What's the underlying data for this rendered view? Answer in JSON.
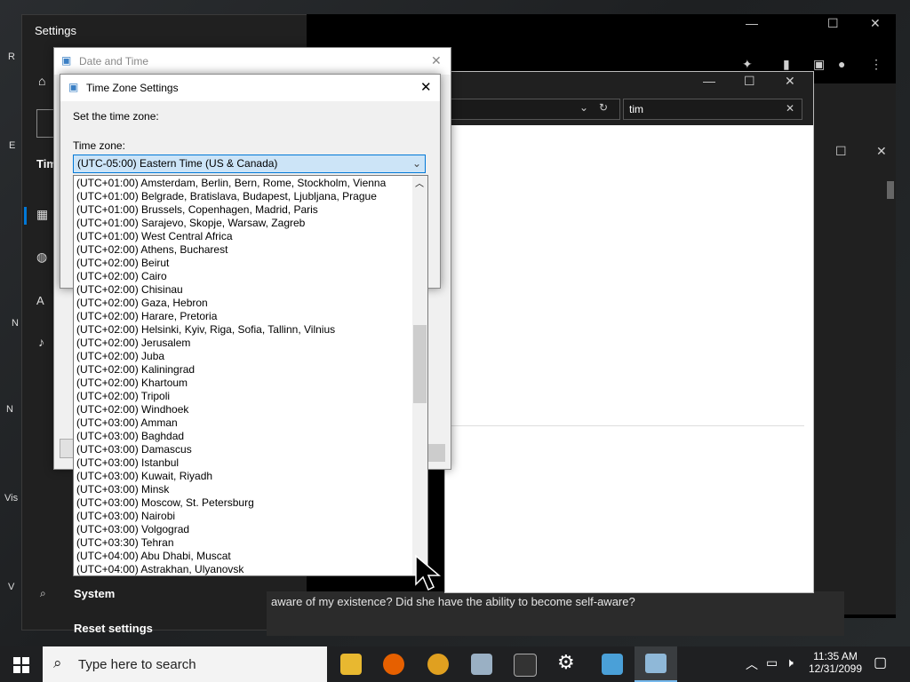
{
  "settings_window": {
    "title": "Settings",
    "nav": [
      "Tim",
      "System",
      "Reset settings"
    ]
  },
  "chrome": {
    "search_value": "tim"
  },
  "chat_text": "aware of my existence? Did she have the ability to become self-aware?",
  "date_time_dialog": {
    "title": "Date and Time"
  },
  "tz_dialog": {
    "title": "Time Zone Settings",
    "instruction": "Set the time zone:",
    "tz_label": "Time zone:",
    "selected": "(UTC-05:00) Eastern Time (US & Canada)",
    "options": [
      "(UTC+01:00) Amsterdam, Berlin, Bern, Rome, Stockholm, Vienna",
      "(UTC+01:00) Belgrade, Bratislava, Budapest, Ljubljana, Prague",
      "(UTC+01:00) Brussels, Copenhagen, Madrid, Paris",
      "(UTC+01:00) Sarajevo, Skopje, Warsaw, Zagreb",
      "(UTC+01:00) West Central Africa",
      "(UTC+02:00) Athens, Bucharest",
      "(UTC+02:00) Beirut",
      "(UTC+02:00) Cairo",
      "(UTC+02:00) Chisinau",
      "(UTC+02:00) Gaza, Hebron",
      "(UTC+02:00) Harare, Pretoria",
      "(UTC+02:00) Helsinki, Kyiv, Riga, Sofia, Tallinn, Vilnius",
      "(UTC+02:00) Jerusalem",
      "(UTC+02:00) Juba",
      "(UTC+02:00) Kaliningrad",
      "(UTC+02:00) Khartoum",
      "(UTC+02:00) Tripoli",
      "(UTC+02:00) Windhoek",
      "(UTC+03:00) Amman",
      "(UTC+03:00) Baghdad",
      "(UTC+03:00) Damascus",
      "(UTC+03:00) Istanbul",
      "(UTC+03:00) Kuwait, Riyadh",
      "(UTC+03:00) Minsk",
      "(UTC+03:00) Moscow, St. Petersburg",
      "(UTC+03:00) Nairobi",
      "(UTC+03:00) Volgograd",
      "(UTC+03:30) Tehran",
      "(UTC+04:00) Abu Dhabi, Muscat",
      "(UTC+04:00) Astrakhan, Ulyanovsk"
    ]
  },
  "taskbar": {
    "search_placeholder": "Type here to search",
    "time": "11:35 AM",
    "date": "12/31/2099"
  },
  "desktop_labels": [
    "R",
    "E",
    "N",
    "Vis",
    "N",
    "V"
  ],
  "colors": {
    "accent": "#0078d7",
    "selection": "#cce4f7",
    "taskbar": "#1f2022"
  }
}
